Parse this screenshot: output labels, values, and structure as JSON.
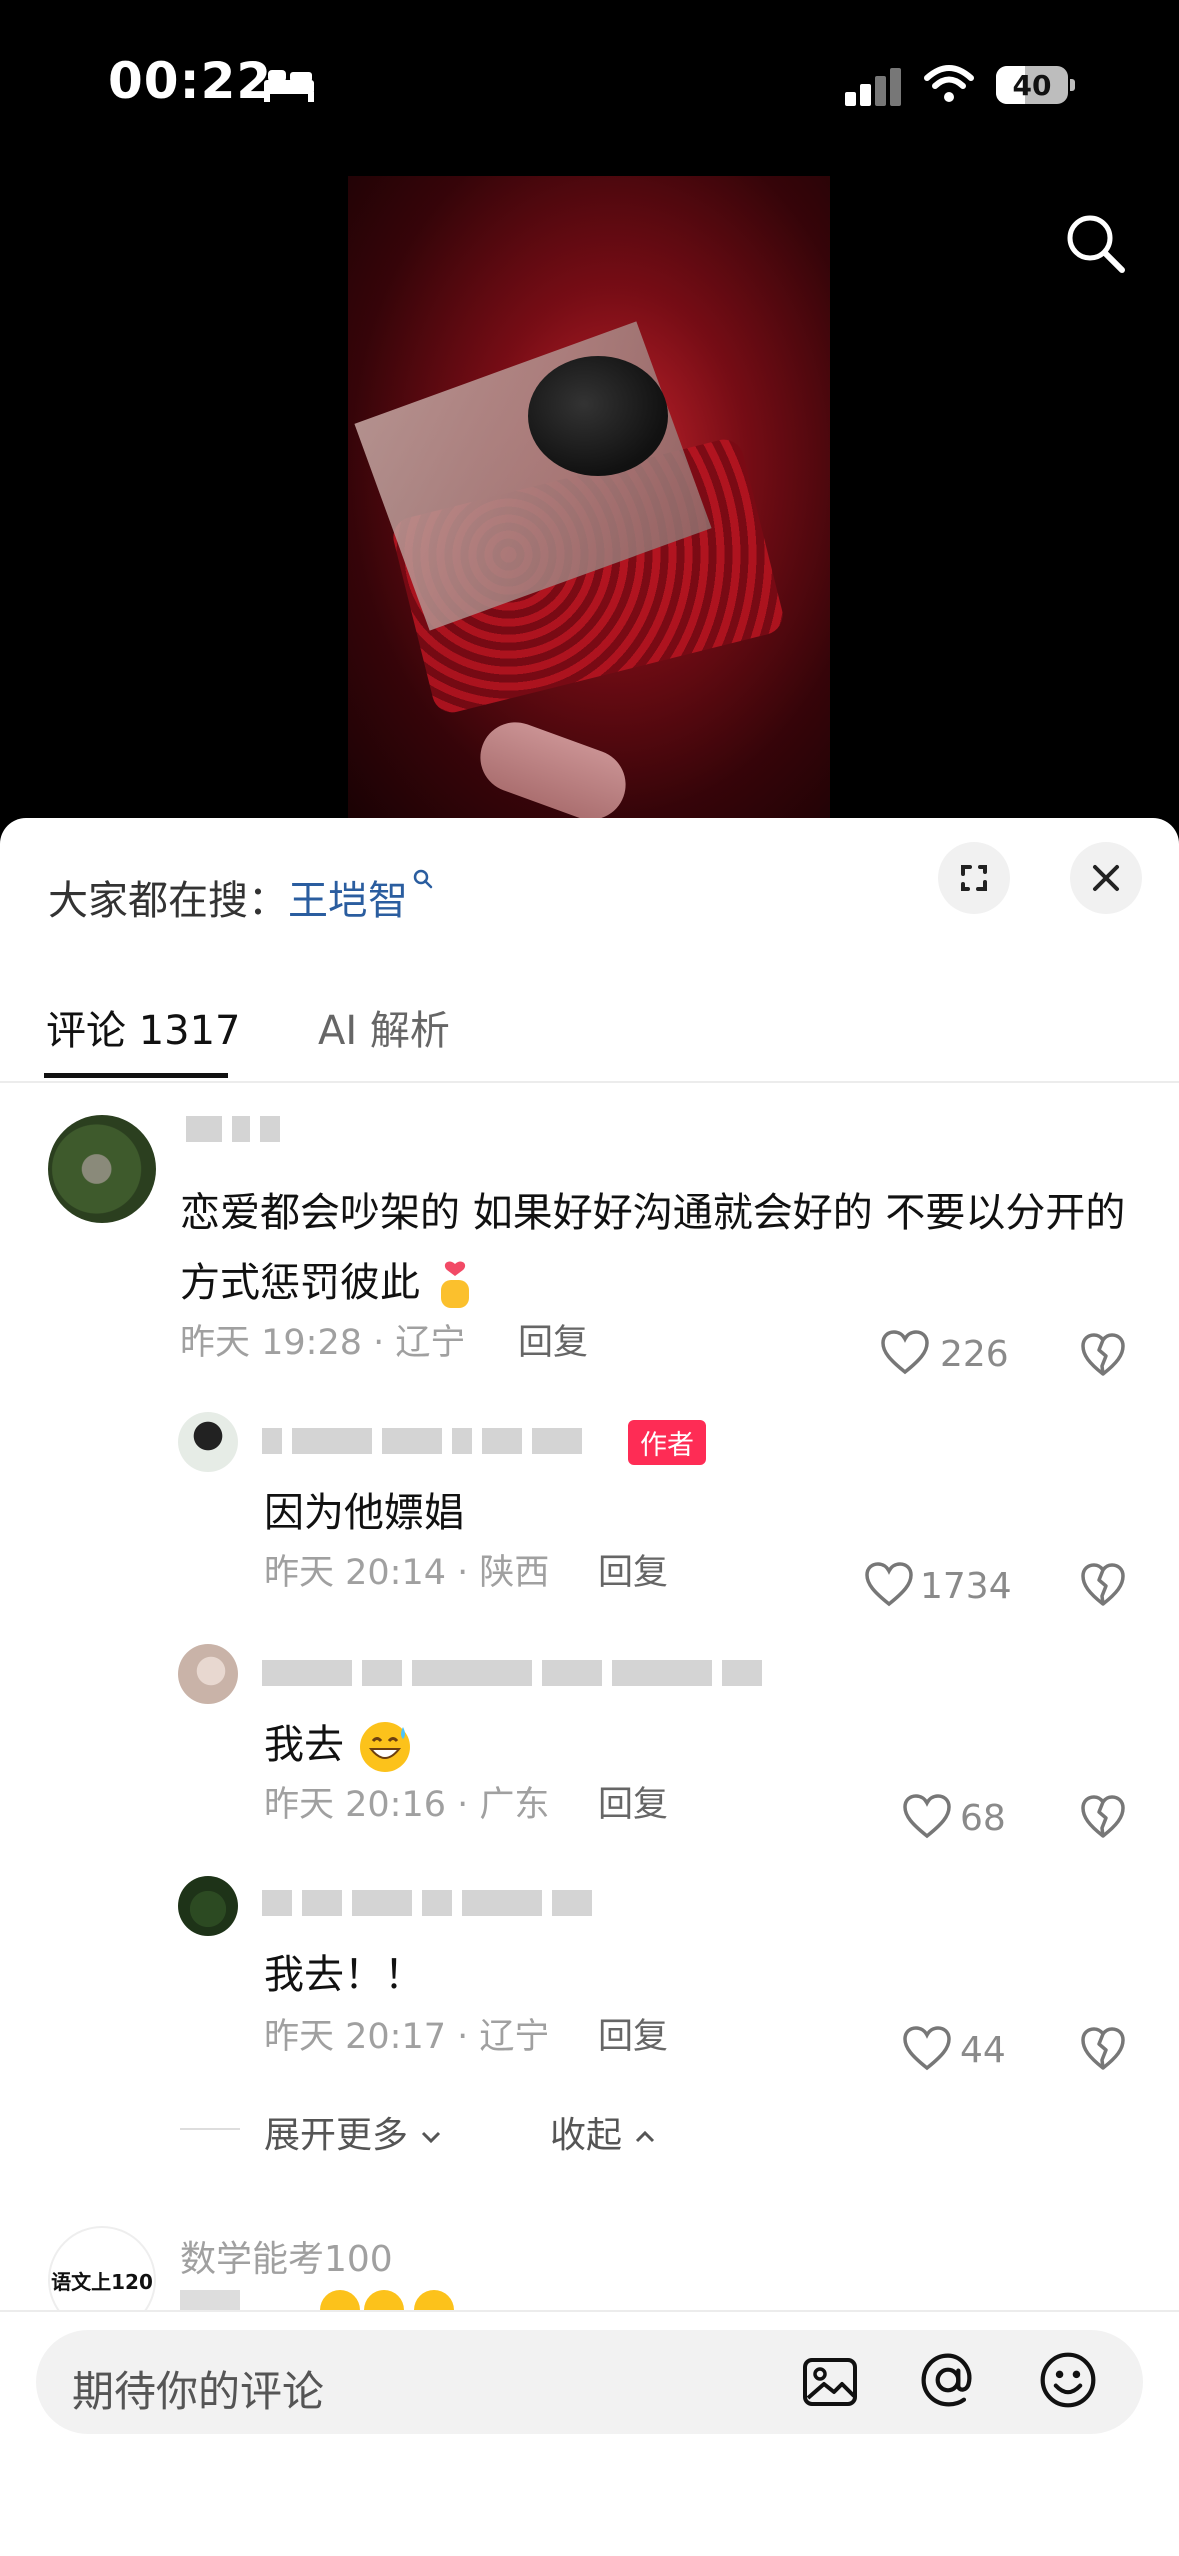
{
  "status_bar": {
    "time": "00:22",
    "battery": "40"
  },
  "search_bar": {
    "prefix": "大家都在搜：",
    "keyword": "王垲智"
  },
  "tabs": [
    {
      "label": "评论 1317",
      "active": true
    },
    {
      "label": "AI 解析",
      "active": false
    }
  ],
  "comments": [
    {
      "text": "恋爱都会吵架的  如果好好沟通就会好的  不要以分开的方式惩罚彼此",
      "meta": "昨天 19:28 · 辽宁",
      "reply": "回复",
      "likes": "226"
    },
    {
      "badge": "作者",
      "text": "因为他嫖娼",
      "meta": "昨天 20:14 · 陕西",
      "reply": "回复",
      "likes": "1734"
    },
    {
      "text": "我去",
      "meta": "昨天 20:16 · 广东",
      "reply": "回复",
      "likes": "68"
    },
    {
      "text": "我去！！",
      "meta": "昨天 20:17 · 辽宁",
      "reply": "回复",
      "likes": "44"
    },
    {
      "username": "数学能考100",
      "avatar_text": "语文上120"
    }
  ],
  "thread_controls": {
    "expand": "展开更多",
    "collapse": "收起"
  },
  "input": {
    "placeholder": "期待你的评论"
  },
  "colors": {
    "accent_red": "#fe2c55",
    "keyword_blue": "#2a5d9f"
  },
  "icons": [
    "search-icon",
    "expand-icon",
    "close-icon",
    "heart-icon",
    "dislike-icon",
    "image-icon",
    "at-icon",
    "emoji-icon"
  ]
}
